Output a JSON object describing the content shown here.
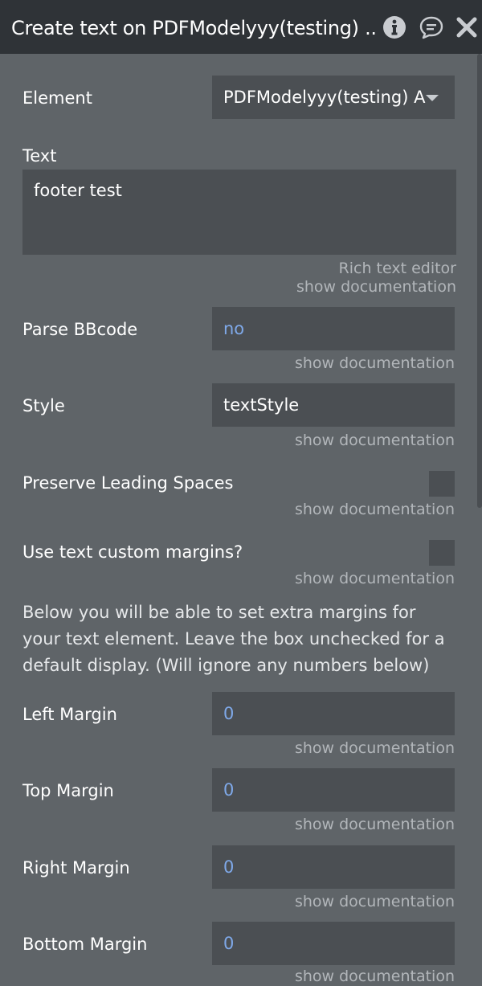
{
  "header": {
    "title": "Create text on PDFModelyyy(testing) ...",
    "icons": [
      "info-icon",
      "comment-icon",
      "close-icon"
    ]
  },
  "fields": {
    "element": {
      "label": "Element",
      "value": "PDFModelyyy(testing) A"
    },
    "text": {
      "label": "Text",
      "value": "footer test",
      "hint": "Rich text editor",
      "doc": "show documentation"
    },
    "parse_bbcode": {
      "label": "Parse BBcode",
      "value": "no",
      "doc": "show documentation"
    },
    "style": {
      "label": "Style",
      "value": "textStyle",
      "doc": "show documentation"
    },
    "preserve_spaces": {
      "label": "Preserve Leading Spaces",
      "checked": false,
      "doc": "show documentation"
    },
    "custom_margins": {
      "label": "Use text custom margins?",
      "checked": false,
      "doc": "show documentation"
    },
    "margins_note": "Below you will be able to set extra margins for your text element. Leave the box unchecked for a default display. (Will ignore any numbers below)",
    "left_margin": {
      "label": "Left Margin",
      "value": "0",
      "doc": "show documentation"
    },
    "top_margin": {
      "label": "Top Margin",
      "value": "0",
      "doc": "show documentation"
    },
    "right_margin": {
      "label": "Right Margin",
      "value": "0",
      "doc": "show documentation"
    },
    "bottom_margin": {
      "label": "Bottom Margin",
      "value": "0",
      "doc": "show documentation"
    }
  },
  "colors": {
    "panel_bg": "#5f6468",
    "header_bg": "#2f3337",
    "field_bg": "#4b4f53",
    "dynamic_value": "#7fa9e9",
    "doc_link": "#b2b6ba"
  }
}
